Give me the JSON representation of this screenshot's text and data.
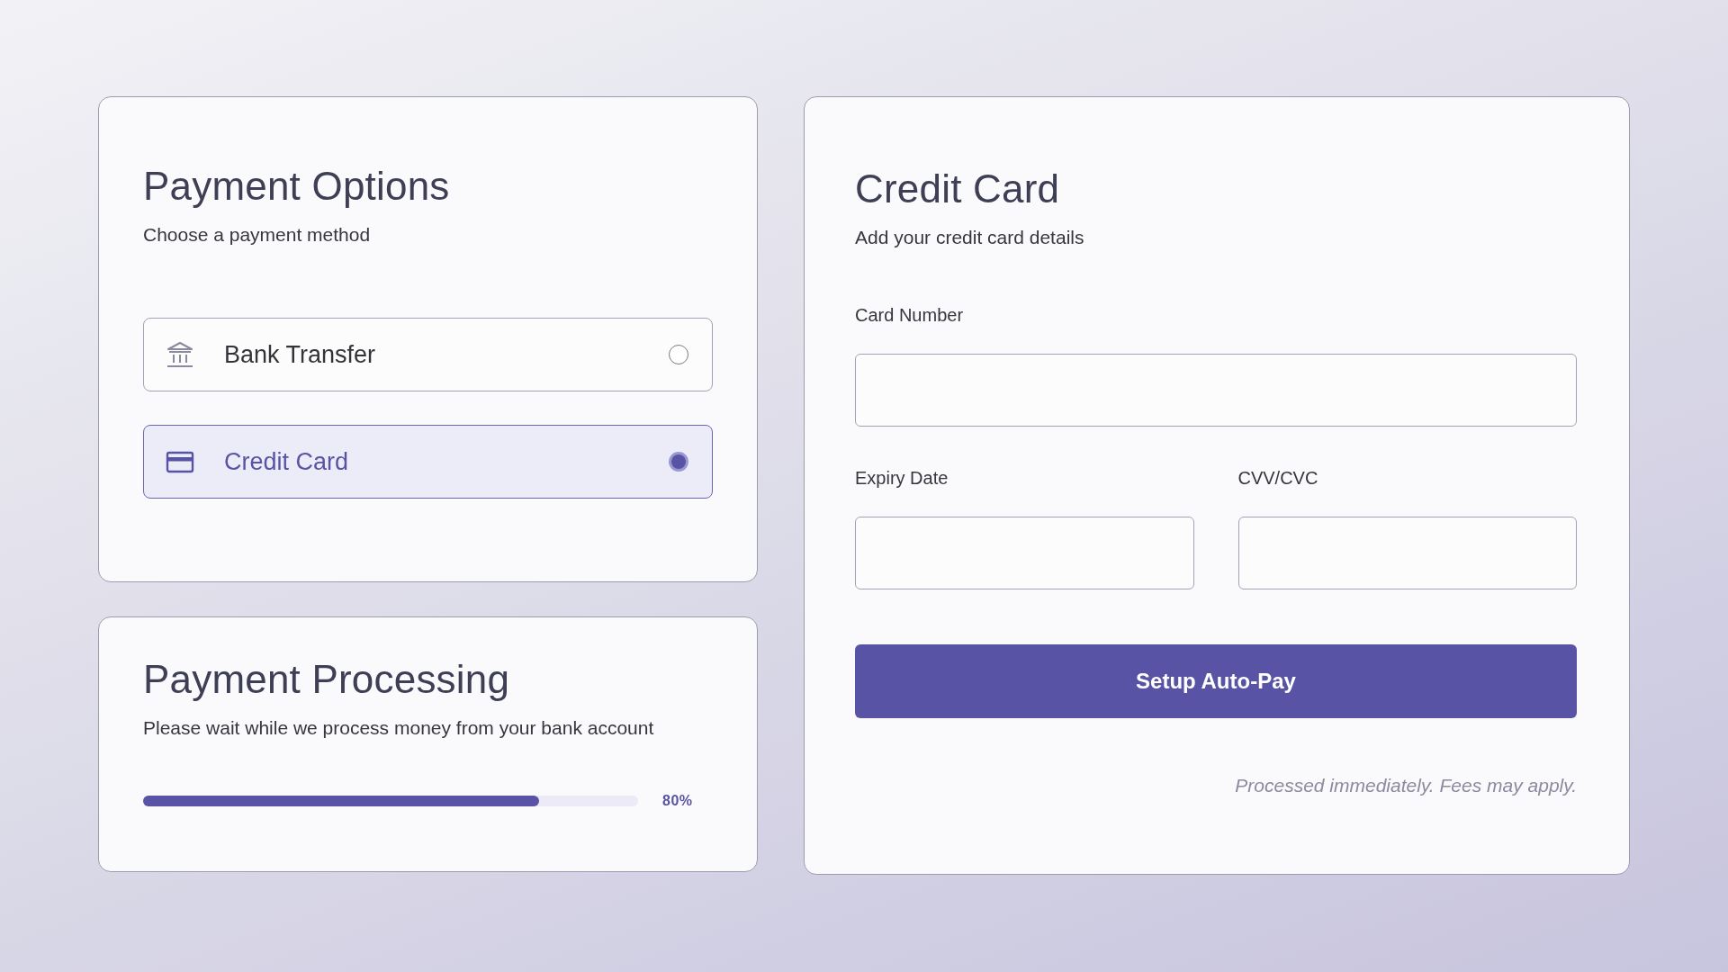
{
  "payment_options": {
    "title": "Payment Options",
    "subtitle": "Choose a payment method",
    "methods": [
      {
        "kind": "bank",
        "label": "Bank Transfer",
        "selected": false
      },
      {
        "kind": "card",
        "label": "Credit Card",
        "selected": true
      }
    ]
  },
  "processing": {
    "title": "Payment Processing",
    "message": "Please wait while we process money from your bank account",
    "level": 0.8,
    "reading": "80%"
  },
  "credit_card": {
    "title": "Credit Card",
    "subtitle": "Add your credit card details",
    "field_rows": [
      {
        "fields": [
          {
            "label": "Card Number"
          }
        ]
      },
      {
        "fields": [
          {
            "label": "Expiry Date"
          },
          {
            "label": "CVV/CVC"
          }
        ]
      }
    ],
    "button": "Setup Auto-Pay",
    "note": "Processed immediately. Fees may apply."
  }
}
